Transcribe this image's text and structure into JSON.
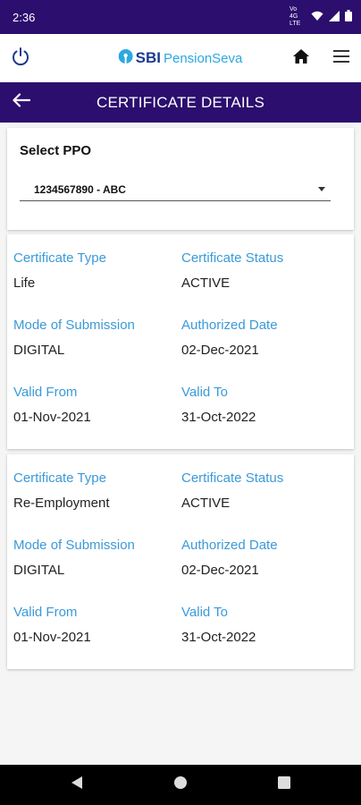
{
  "status_bar": {
    "time": "2:36",
    "network_label": "Vo 4G LTE"
  },
  "header": {
    "logo_sbi": "SBI",
    "logo_pensionseva": "PensionSeva"
  },
  "title_bar": {
    "title": "CERTIFICATE DETAILS"
  },
  "ppo": {
    "label": "Select PPO",
    "selected": "1234567890 - ABC"
  },
  "certificates": [
    {
      "type_label": "Certificate Type",
      "type_value": "Life",
      "status_label": "Certificate Status",
      "status_value": "ACTIVE",
      "mode_label": "Mode of Submission",
      "mode_value": "DIGITAL",
      "auth_label": "Authorized Date",
      "auth_value": "02-Dec-2021",
      "from_label": "Valid From",
      "from_value": "01-Nov-2021",
      "to_label": "Valid To",
      "to_value": "31-Oct-2022"
    },
    {
      "type_label": "Certificate Type",
      "type_value": "Re-Employment",
      "status_label": "Certificate Status",
      "status_value": "ACTIVE",
      "mode_label": "Mode of Submission",
      "mode_value": "DIGITAL",
      "auth_label": "Authorized Date",
      "auth_value": "02-Dec-2021",
      "from_label": "Valid From",
      "from_value": "01-Nov-2021",
      "to_label": "Valid To",
      "to_value": "31-Oct-2022"
    }
  ],
  "colors": {
    "primary": "#2b0e6e",
    "label_blue": "#3b9ad9",
    "logo_blue": "#2aa9e0"
  },
  "icons": [
    "power-icon",
    "home-icon",
    "menu-icon",
    "back-arrow-icon",
    "nav-back-icon",
    "nav-home-icon",
    "nav-recents-icon",
    "wifi-icon",
    "signal-icon",
    "battery-icon"
  ]
}
